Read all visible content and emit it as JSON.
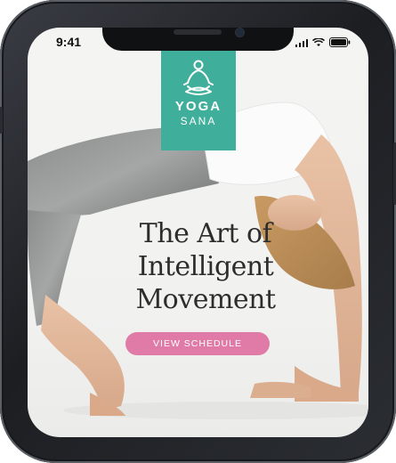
{
  "status_bar": {
    "time": "9:41"
  },
  "brand": {
    "name": "YOGA",
    "sub": "SANA",
    "color": "#3fae9b"
  },
  "hero": {
    "headline_lines": [
      "The Art of",
      "Intelligent",
      "Movement"
    ],
    "cta_label": "VIEW SCHEDULE",
    "cta_color": "#e07ba8"
  },
  "icons": [
    "meditation-icon",
    "signal-icon",
    "wifi-icon",
    "battery-icon"
  ]
}
